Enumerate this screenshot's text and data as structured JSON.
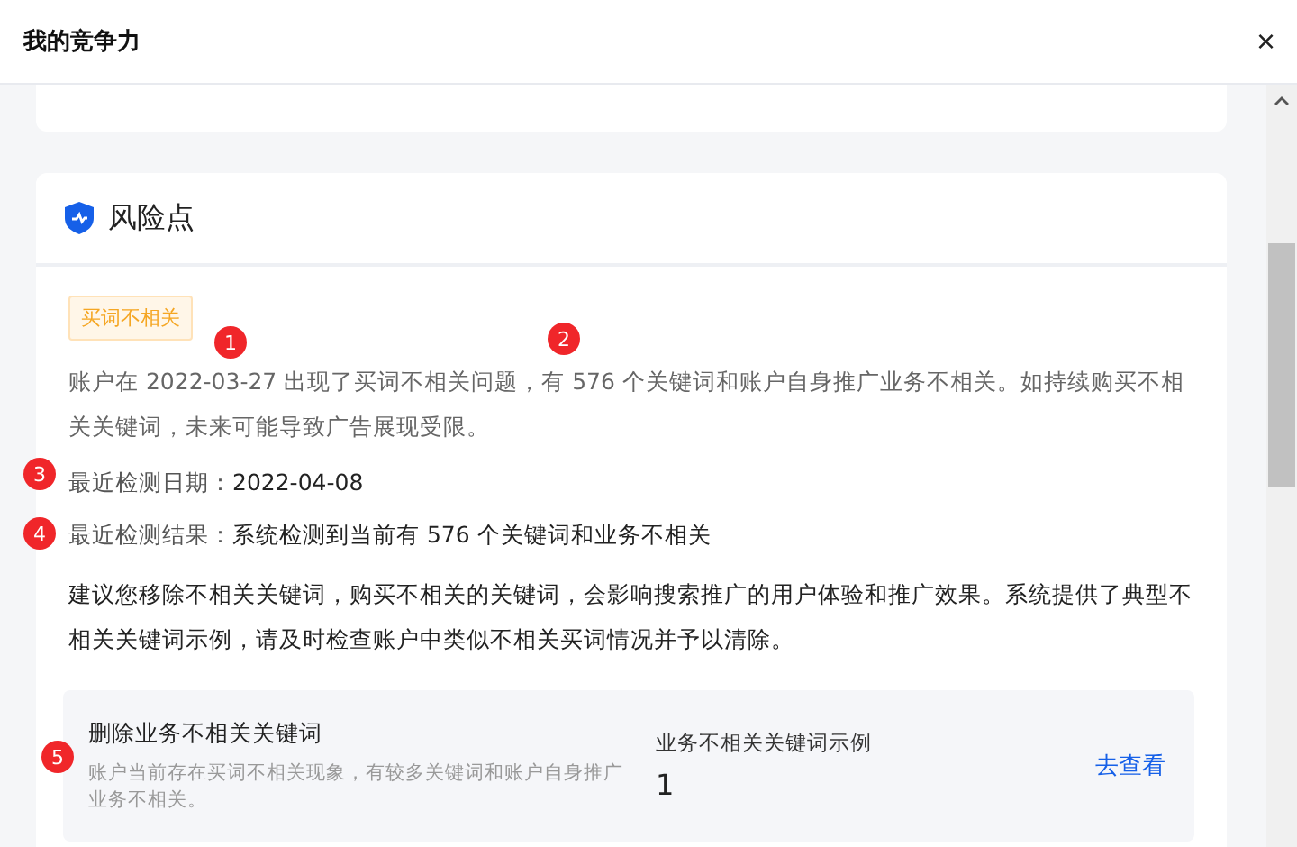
{
  "window": {
    "title": "我的竞争力",
    "close": "×"
  },
  "risk_card": {
    "title": "风险点",
    "tag": "买词不相关",
    "description": "账户在 2022-03-27 出现了买词不相关问题，有 576 个关键词和账户自身推广业务不相关。如持续购买不相关关键词，未来可能导致广告展现受限。",
    "facts": [
      {
        "label": "最近检测日期：",
        "value": "2022-04-08"
      },
      {
        "label": "最近检测结果：",
        "value": "系统检测到当前有 576 个关键词和业务不相关"
      }
    ],
    "advice": "建议您移除不相关关键词，购买不相关的关键词，会影响搜索推广的用户体验和推广效果。系统提供了典型不相关关键词示例，请及时检查账户中类似不相关买词情况并予以清除。",
    "action": {
      "title": "删除业务不相关关键词",
      "description": "账户当前存在买词不相关现象，有较多关键词和账户自身推广业务不相关。",
      "metric_label": "业务不相关关键词示例",
      "metric_value": "1",
      "link": "去查看"
    }
  },
  "annotations": [
    {
      "label": "1"
    },
    {
      "label": "2"
    },
    {
      "label": "3"
    },
    {
      "label": "4"
    },
    {
      "label": "5"
    }
  ]
}
